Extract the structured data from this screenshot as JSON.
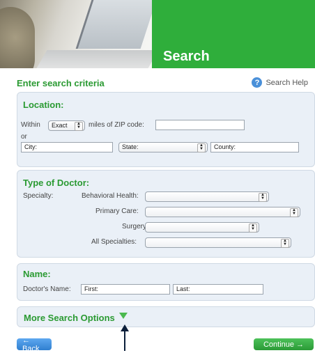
{
  "header": {
    "title": "Search"
  },
  "criteria_title": "Enter search criteria",
  "help_label": "Search Help",
  "location": {
    "title": "Location:",
    "within_label": "Within",
    "within_value": "Exact",
    "miles_label": "miles of ZIP code:",
    "zip_value": "",
    "or_label": "or",
    "city_value": "City:",
    "state_value": "State:",
    "county_value": "County:"
  },
  "doctor_type": {
    "title": "Type of Doctor:",
    "specialty_label": "Specialty:",
    "behavioral_label": "Behavioral Health:",
    "primary_label": "Primary Care:",
    "surgery_label": "Surgery:",
    "all_label": "All Specialties:"
  },
  "name": {
    "title": "Name:",
    "doctor_label": "Doctor's Name:",
    "first_value": "First:",
    "last_value": "Last:"
  },
  "more_options": "More Search Options",
  "buttons": {
    "back": "← Back",
    "continue": "Continue →"
  },
  "colors": {
    "brand_green": "#2fae3b",
    "heading_green": "#2a9a32",
    "panel_bg": "#eaf0f7",
    "back_blue": "#2f7fd0"
  }
}
